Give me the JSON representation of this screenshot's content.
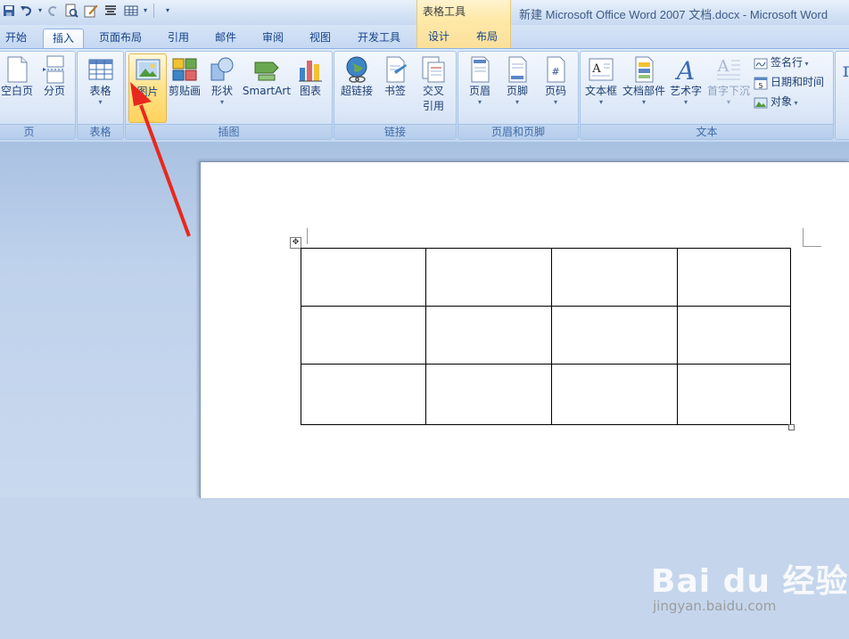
{
  "qat": {
    "icons": [
      "save-icon",
      "undo-icon",
      "redo-icon",
      "print-preview-icon",
      "edit-icon",
      "align-icon",
      "table-icon",
      "customize-icon"
    ]
  },
  "contextual_tab_group": {
    "title": "表格工具"
  },
  "window_title": "新建 Microsoft Office Word 2007 文档.docx - Microsoft Word",
  "tabs": [
    {
      "label": "开始"
    },
    {
      "label": "插入",
      "active": true
    },
    {
      "label": "页面布局"
    },
    {
      "label": "引用"
    },
    {
      "label": "邮件"
    },
    {
      "label": "审阅"
    },
    {
      "label": "视图"
    },
    {
      "label": "开发工具"
    },
    {
      "label": "设计"
    },
    {
      "label": "布局"
    }
  ],
  "ribbon": {
    "groups": {
      "page": {
        "label": "页",
        "blank_page": "空白页",
        "page_break": "分页"
      },
      "tables": {
        "label": "表格",
        "table": "表格"
      },
      "illustrations": {
        "label": "插图",
        "picture": "图片",
        "clip_art": "剪贴画",
        "shapes": "形状",
        "smartart": "SmartArt",
        "chart": "图表"
      },
      "links": {
        "label": "链接",
        "hyperlink": "超链接",
        "bookmark": "书签",
        "cross_reference_1": "交叉",
        "cross_reference_2": "引用"
      },
      "header_footer": {
        "label": "页眉和页脚",
        "header": "页眉",
        "footer": "页脚",
        "page_number": "页码"
      },
      "text": {
        "label": "文本",
        "text_box": "文本框",
        "quick_parts": "文档部件",
        "wordart": "艺术字",
        "drop_cap": "首字下沉",
        "signature_line": "签名行",
        "date_time": "日期和时间",
        "object": "对象"
      }
    }
  },
  "document": {
    "table": {
      "rows": 3,
      "cols": 4
    }
  },
  "colors": {
    "accent_arrow": "#e8281e",
    "hot_button": "#ffd35c"
  },
  "watermark": {
    "brand": "Bai du 经验",
    "url": "jingyan.baidu.com"
  }
}
